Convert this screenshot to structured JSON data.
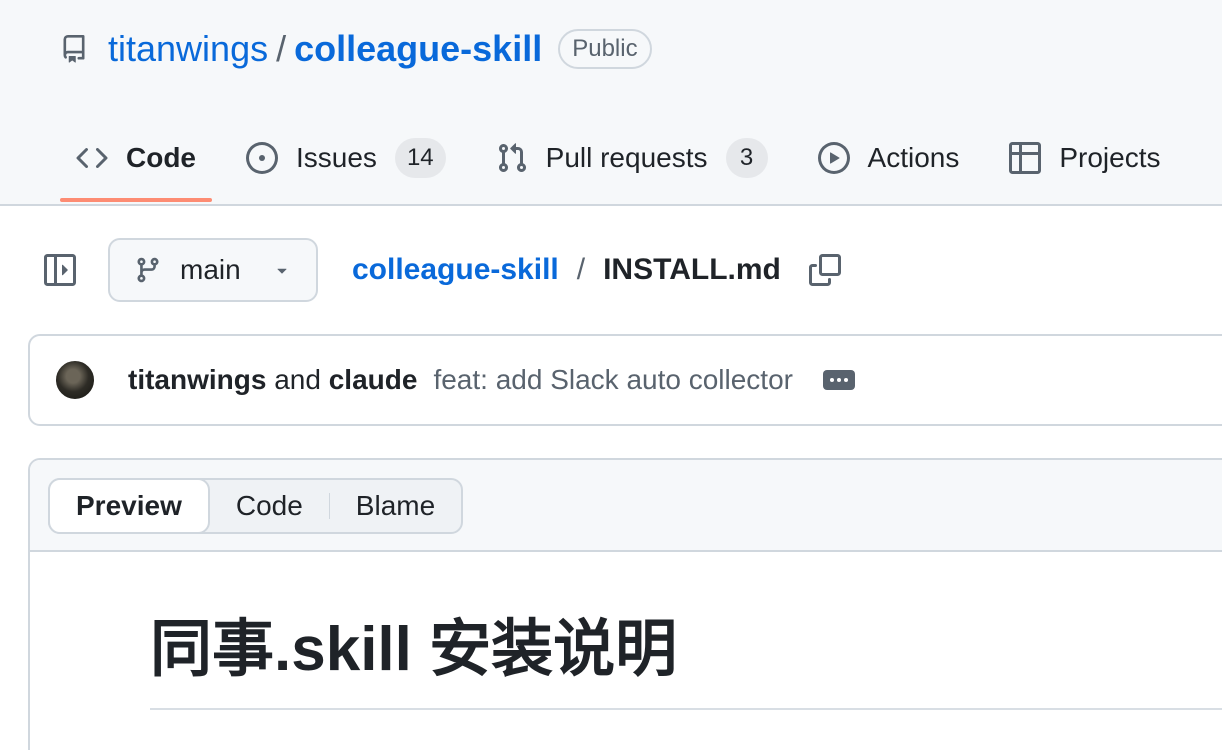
{
  "repo": {
    "owner": "titanwings",
    "separator": "/",
    "name": "colleague-skill",
    "visibility": "Public",
    "icon": "repo-icon"
  },
  "tabs": [
    {
      "label": "Code",
      "icon": "code-icon",
      "active": true
    },
    {
      "label": "Issues",
      "icon": "issue-icon",
      "count": "14"
    },
    {
      "label": "Pull requests",
      "icon": "pull-request-icon",
      "count": "3"
    },
    {
      "label": "Actions",
      "icon": "play-icon"
    },
    {
      "label": "Projects",
      "icon": "table-icon"
    }
  ],
  "file_nav": {
    "branch": "main",
    "breadcrumb_repo": "colleague-skill",
    "breadcrumb_sep": "/",
    "file_name": "INSTALL.md"
  },
  "commit": {
    "author1": "titanwings",
    "conjunction": "and",
    "author2": "claude",
    "message": "feat: add Slack auto collector"
  },
  "view_tabs": {
    "preview": "Preview",
    "code": "Code",
    "blame": "Blame"
  },
  "document": {
    "title": "同事.skill 安装说明"
  },
  "colors": {
    "link": "#0969da",
    "active_tab_underline": "#fd8c73",
    "header_bg": "#f6f8fa",
    "border": "#d0d7de"
  }
}
